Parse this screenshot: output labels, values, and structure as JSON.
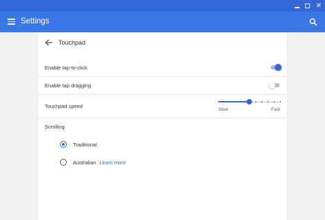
{
  "window": {
    "controls": [
      {
        "name": "minimize-icon"
      },
      {
        "name": "maximize-icon"
      },
      {
        "name": "close-icon",
        "glyph": "✕"
      }
    ]
  },
  "appbar": {
    "title": "Settings",
    "icons": [
      "menu-icon",
      "search-icon"
    ]
  },
  "page": {
    "title": "Touchpad",
    "back_icon": "arrow-left-icon"
  },
  "settings": {
    "tap_to_click": {
      "label": "Enable tap-to-click",
      "enabled": true
    },
    "tap_dragging": {
      "label": "Enable tap dragging",
      "enabled": false
    },
    "touchpad_speed": {
      "label": "Touchpad speed",
      "min_label": "Slow",
      "max_label": "Fast",
      "value_fraction": 0.5
    }
  },
  "scrolling": {
    "header": "Scrolling",
    "options": [
      {
        "label": "Traditional",
        "selected": true
      },
      {
        "label": "Australian",
        "selected": false,
        "link": "Learn more"
      }
    ]
  },
  "colors": {
    "titlebar": "#3367d6",
    "appbar": "#3b78e7",
    "accent": "#3367d6",
    "background": "#f1f1f1"
  }
}
